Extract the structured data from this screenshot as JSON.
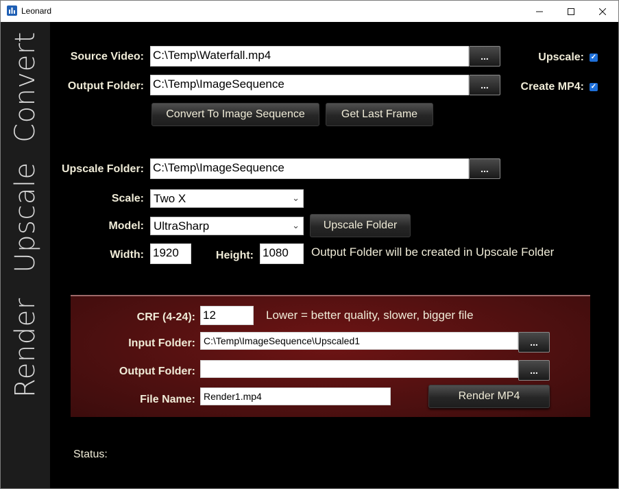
{
  "window": {
    "title": "Leonard"
  },
  "sidebar": {
    "tabs": [
      "Convert",
      "Upscale",
      "Render"
    ]
  },
  "convert": {
    "source_label": "Source Video:",
    "source_value": "C:\\Temp\\Waterfall.mp4",
    "output_label": "Output Folder:",
    "output_value": "C:\\Temp\\ImageSequence",
    "browse_label": "...",
    "upscale_label": "Upscale:",
    "upscale_checked": true,
    "create_mp4_label": "Create MP4:",
    "create_mp4_checked": true,
    "convert_button": "Convert To Image Sequence",
    "last_frame_button": "Get Last Frame"
  },
  "upscale": {
    "folder_label": "Upscale Folder:",
    "folder_value": "C:\\Temp\\ImageSequence",
    "scale_label": "Scale:",
    "scale_value": "Two X",
    "model_label": "Model:",
    "model_value": "UltraSharp",
    "upscale_button": "Upscale Folder",
    "width_label": "Width:",
    "width_value": "1920",
    "height_label": "Height:",
    "height_value": "1080",
    "note": "Output Folder will be created in Upscale Folder"
  },
  "render": {
    "crf_label": "CRF (4-24):",
    "crf_value": "12",
    "crf_note": "Lower = better quality, slower, bigger file",
    "input_label": "Input Folder:",
    "input_value": "C:\\Temp\\ImageSequence\\Upscaled1",
    "output_label": "Output Folder:",
    "output_value": "",
    "file_label": "File Name:",
    "file_value": "Render1.mp4",
    "render_button": "Render MP4"
  },
  "status": {
    "label": "Status:",
    "value": ""
  },
  "colors": {
    "background": "#000000",
    "sidebar": "#1c1c1c",
    "render_panel": "#5a1212",
    "label_text": "#f0ecd8",
    "checkbox": "#1e6fd8"
  }
}
